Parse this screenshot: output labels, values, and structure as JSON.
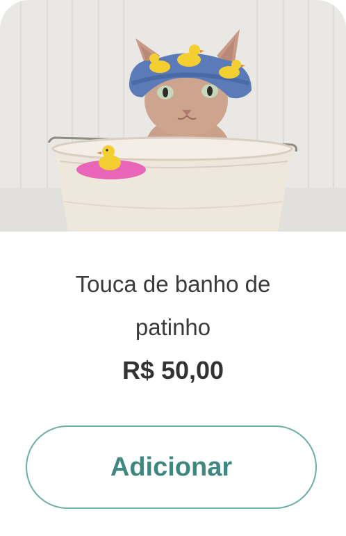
{
  "product": {
    "image_alt": "Hairless sphynx cat wearing a blue shower cap with rubber ducks, sitting in a white metal bucket",
    "name": "Touca de banho de patinho",
    "price": "R$ 50,00",
    "add_label": "Adicionar"
  },
  "colors": {
    "accent": "#6aaea6",
    "accent_text": "#3f877f",
    "title_text": "#3a3a3a",
    "price_text": "#333333",
    "background": "#ffffff"
  }
}
